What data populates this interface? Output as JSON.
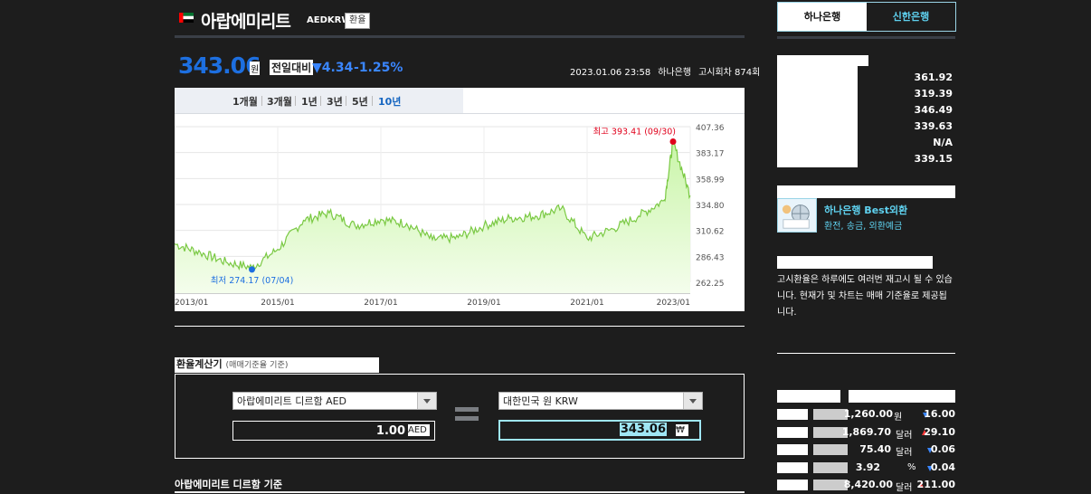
{
  "header": {
    "title": "아랍에미리트",
    "code": "AEDKRW",
    "chip": "환율",
    "flag": "uae-flag"
  },
  "quote": {
    "price": "343.06",
    "unit": "원",
    "compare_label": "전일대비",
    "change": "4.34",
    "change_pct": "1.25%",
    "direction": "down",
    "date": "2023.01.06 23:58",
    "bank": "하나은행",
    "round": "고시회차 874회"
  },
  "chart_tabs": [
    "1개월",
    "3개월",
    "1년",
    "3년",
    "5년",
    "10년"
  ],
  "chart_active_tab": "10년",
  "chart_data": {
    "type": "area",
    "x": [
      "2013/01",
      "2013/07",
      "2014/01",
      "2014/07",
      "2015/01",
      "2015/07",
      "2016/01",
      "2016/07",
      "2017/01",
      "2017/07",
      "2018/01",
      "2018/07",
      "2019/01",
      "2019/07",
      "2020/01",
      "2020/07",
      "2021/01",
      "2021/07",
      "2022/01",
      "2022/07",
      "2022/09",
      "2023/01"
    ],
    "y": [
      298,
      290,
      281,
      276,
      293,
      320,
      327,
      315,
      321,
      317,
      302,
      304,
      315,
      322,
      324,
      331,
      303,
      312,
      324,
      339,
      393,
      343
    ],
    "xticks": [
      "2013/01",
      "2015/01",
      "2017/01",
      "2019/01",
      "2021/01",
      "2023/01"
    ],
    "yticks": [
      "407.36",
      "383.17",
      "358.99",
      "334.80",
      "310.62",
      "286.43",
      "262.25"
    ],
    "ylim": [
      262.25,
      407.36
    ],
    "annotations": [
      {
        "label": "최고 393.41 (09/30)",
        "value": 393.41,
        "color": "#e0001b"
      },
      {
        "label": "최저 274.17 (07/04)",
        "value": 274.17,
        "color": "#1d6fe0"
      }
    ],
    "line_color": "#7ac943",
    "fill_color": "#c9f5a8"
  },
  "calculator": {
    "title": "환율계산기",
    "subtitle": "(매매기준율 기준)",
    "from_select": "아랍에미리트 디르함 AED",
    "from_value": "1.00",
    "from_unit": "AED",
    "to_select": "대한민국 원 KRW",
    "to_value": "343.06",
    "to_unit": "₩"
  },
  "base_title": "아랍에미리트 디르함 기준",
  "bank_tabs": [
    {
      "label": "하나은행",
      "active": true
    },
    {
      "label": "신한은행",
      "active": false
    }
  ],
  "rates": [
    "361.92",
    "319.39",
    "346.49",
    "339.63",
    "N/A",
    "339.15"
  ],
  "promo": {
    "title": "하나은행 Best외환",
    "subtitle": "환전, 송금, 외환예금"
  },
  "notice": "고시환율은 하루에도 여러번 재고시 될 수 있습니다. 현재가 및 차트는 매매 기준율로 제공됩니다.",
  "cross_rates": [
    {
      "value": "1,260.00",
      "unit": "원",
      "dir": "down",
      "change": "16.00"
    },
    {
      "value": "1,869.70",
      "unit": "달러",
      "dir": "up",
      "change": "29.10"
    },
    {
      "value": "75.40",
      "unit": "달러",
      "dir": "down",
      "change": "0.06"
    },
    {
      "value": "3.92",
      "unit": "%",
      "dir": "down",
      "change": "0.04"
    },
    {
      "value": "8,420.00",
      "unit": "달러",
      "dir": "up",
      "change": "211.00"
    }
  ],
  "colors": {
    "accent_blue": "#1d6fe0",
    "down": "#3a86ff",
    "up": "#ff3a3a",
    "cyan": "#5fd2f0"
  }
}
